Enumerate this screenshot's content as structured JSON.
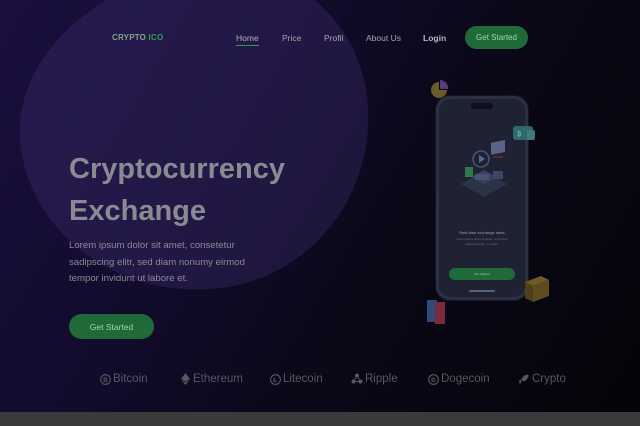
{
  "logo": {
    "text_main": "CRYPTO",
    "text_accent": "ICO"
  },
  "nav": {
    "items": [
      "Home",
      "Price",
      "Profil",
      "About Us"
    ],
    "login": "Login",
    "cta": "Get Started"
  },
  "hero": {
    "title_line1": "Cryptocurrency",
    "title_line2": "Exchange",
    "description": "Lorem ipsum dolor sit amet, consetetur sadipscing elitr, sed diam nonumy eirmod tempor invidunt ut labore et.",
    "cta": "Get Started"
  },
  "phone": {
    "title": "Real time exchange rates",
    "subtitle": "Lorem ipsum dolor sit amet, consetetur sadipscing elitr, sed diam",
    "button": "Get Started"
  },
  "coins": [
    {
      "label": "Bitcoin",
      "icon": "bitcoin-icon"
    },
    {
      "label": "Ethereum",
      "icon": "ethereum-icon"
    },
    {
      "label": "Litecoin",
      "icon": "litecoin-icon"
    },
    {
      "label": "Ripple",
      "icon": "ripple-icon"
    },
    {
      "label": "Dogecoin",
      "icon": "dogecoin-icon"
    },
    {
      "label": "Crypto",
      "icon": "rocket-icon"
    }
  ],
  "colors": {
    "accent": "#2f9e53",
    "button_bg": "#1f6a38",
    "background": "#0a0814"
  }
}
